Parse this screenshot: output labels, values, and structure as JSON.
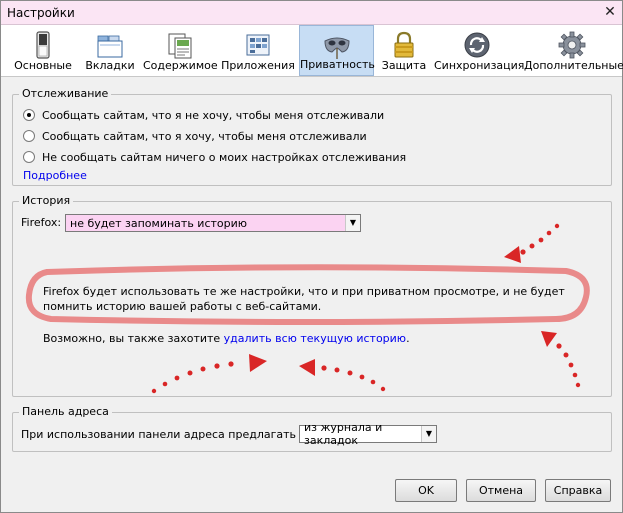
{
  "window": {
    "title": "Настройки",
    "close_glyph": "✕"
  },
  "toolbar": {
    "tabs": [
      {
        "label": "Основные",
        "icon": "switch-icon"
      },
      {
        "label": "Вкладки",
        "icon": "tabs-icon"
      },
      {
        "label": "Содержимое",
        "icon": "content-icon"
      },
      {
        "label": "Приложения",
        "icon": "applications-icon"
      },
      {
        "label": "Приватность",
        "icon": "mask-icon",
        "active": true
      },
      {
        "label": "Защита",
        "icon": "lock-icon"
      },
      {
        "label": "Синхронизация",
        "icon": "sync-icon"
      },
      {
        "label": "Дополнительные",
        "icon": "gear-icon"
      }
    ]
  },
  "tracking": {
    "title": "Отслеживание",
    "options": [
      {
        "label": "Сообщать сайтам, что я не хочу, чтобы меня отслеживали",
        "checked": true
      },
      {
        "label": "Сообщать сайтам, что я хочу, чтобы меня отслеживали",
        "checked": false
      },
      {
        "label": "Не сообщать сайтам ничего о моих настройках отслеживания",
        "checked": false
      }
    ],
    "more_link": "Подробнее"
  },
  "history": {
    "title": "История",
    "firefox_label": "Firefox:",
    "mode_value": "не будет запоминать историю",
    "description": "Firefox будет использовать те же настройки, что и при приватном просмотре, и не будет помнить историю вашей работы с веб-сайтами.",
    "clear_prefix": "Возможно, вы также захотите ",
    "clear_link": "удалить всю текущую историю",
    "clear_suffix": "."
  },
  "addressbar": {
    "title": "Панель адреса",
    "label": "При использовании панели адреса предлагать ссылки:",
    "value": "из журнала и закладок"
  },
  "buttons": {
    "ok": "OK",
    "cancel": "Отмена",
    "help": "Справка"
  },
  "colors": {
    "titlebar": "#fbe5f4",
    "combo_highlight": "#fbd3f2",
    "annotation_red": "#d92626",
    "annotation_pink": "#e98a8a",
    "active_tab": "#c7ddf4",
    "link": "#0000ee"
  }
}
